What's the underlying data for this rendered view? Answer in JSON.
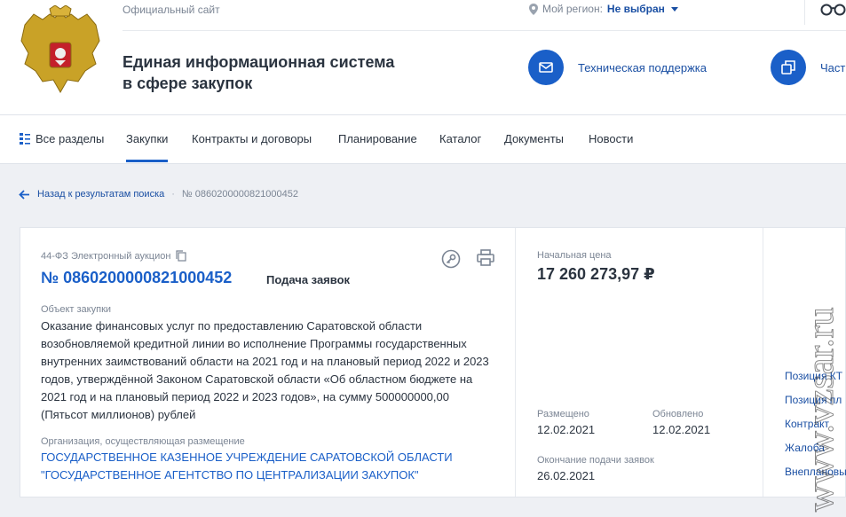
{
  "header": {
    "official": "Официальный сайт",
    "title_line1": "Единая информационная система",
    "title_line2": "в сфере закупок",
    "region_label": "Мой регион:",
    "region_value": "Не выбран",
    "support": "Техническая поддержка",
    "faq": "Част"
  },
  "nav": {
    "all": "Все разделы",
    "items": [
      "Закупки",
      "Контракты и договоры",
      "Планирование",
      "Каталог",
      "Документы",
      "Новости"
    ]
  },
  "breadcrumb": {
    "back": "Назад к результатам поиска",
    "current": "№ 0860200000821000452"
  },
  "card": {
    "law": "44-ФЗ Электронный аукцион",
    "number": "№ 0860200000821000452",
    "stage": "Подача заявок",
    "object_label": "Объект закупки",
    "object_text": "Оказание финансовых услуг по предоставлению Саратовской области возобновляемой кредитной линии во исполнение Программы государственных внутренних заимствований области на 2021 год и на плановый период 2022 и 2023 годов, утверждённой Законом Саратовской области «Об областном бюджете на 2021 год и на плановый период 2022 и 2023 годов», на сумму 500000000,00 (Пятьсот миллионов) рублей",
    "org_label": "Организация, осуществляющая размещение",
    "org_text": "ГОСУДАРСТВЕННОЕ КАЗЕННОЕ УЧРЕЖДЕНИЕ САРАТОВСКОЙ ОБЛАСТИ \"ГОСУДАРСТВЕННОЕ АГЕНТСТВО ПО ЦЕНТРАЛИЗАЦИИ ЗАКУПОК\"",
    "price_label": "Начальная цена",
    "price": "17 260 273,97 ₽",
    "placed_label": "Размещено",
    "placed": "12.02.2021",
    "updated_label": "Обновлено",
    "updated": "12.02.2021",
    "deadline_label": "Окончание подачи заявок",
    "deadline": "26.02.2021"
  },
  "side_links": [
    "Позиция КТ",
    "Позиция пл",
    "Контракт",
    "Жалоба",
    "Внеплановы"
  ],
  "watermark": "www.vzsar.ru",
  "colors": {
    "accent": "#1a5fc8",
    "link": "#1a4fa3",
    "text": "#2b3440",
    "muted": "#7b8594"
  }
}
